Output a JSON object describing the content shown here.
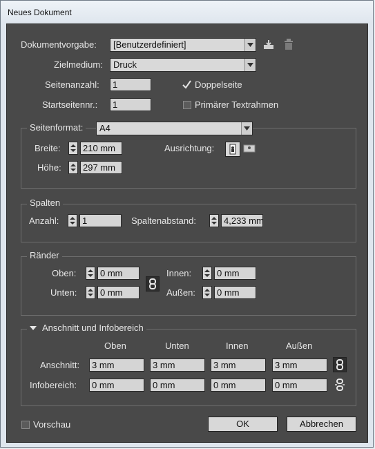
{
  "window": {
    "title": "Neues Dokument"
  },
  "preset": {
    "label": "Dokumentvorgabe:",
    "value": "[Benutzerdefiniert]"
  },
  "intent": {
    "label": "Zielmedium:",
    "value": "Druck"
  },
  "pages": {
    "label": "Seitenanzahl:",
    "value": "1"
  },
  "start_page": {
    "label": "Startseitennr.:",
    "value": "1"
  },
  "facing_pages": {
    "label": "Doppelseite",
    "checked": true
  },
  "primary_text_frame": {
    "label": "Primärer Textrahmen",
    "checked": false
  },
  "page_size": {
    "group_label": "Seitenformat:",
    "value": "A4",
    "width_label": "Breite:",
    "width_value": "210 mm",
    "height_label": "Höhe:",
    "height_value": "297 mm",
    "orientation_label": "Ausrichtung:"
  },
  "columns": {
    "group_label": "Spalten",
    "number_label": "Anzahl:",
    "number_value": "1",
    "gutter_label": "Spaltenabstand:",
    "gutter_value": "4,233 mm"
  },
  "margins": {
    "group_label": "Ränder",
    "top_label": "Oben:",
    "top_value": "0 mm",
    "bottom_label": "Unten:",
    "bottom_value": "0 mm",
    "inside_label": "Innen:",
    "inside_value": "0 mm",
    "outside_label": "Außen:",
    "outside_value": "0 mm"
  },
  "bleed_slug": {
    "group_label": "Anschnitt und Infobereich",
    "col_top": "Oben",
    "col_bottom": "Unten",
    "col_inside": "Innen",
    "col_outside": "Außen",
    "bleed_label": "Anschnitt:",
    "bleed_values": [
      "3 mm",
      "3 mm",
      "3 mm",
      "3 mm"
    ],
    "slug_label": "Infobereich:",
    "slug_values": [
      "0 mm",
      "0 mm",
      "0 mm",
      "0 mm"
    ]
  },
  "preview": {
    "label": "Vorschau",
    "checked": false
  },
  "buttons": {
    "ok": "OK",
    "cancel": "Abbrechen"
  },
  "icons": {
    "save_preset": "save-preset-icon",
    "delete_preset": "trash-icon",
    "portrait": "portrait-orientation-icon",
    "landscape": "landscape-orientation-icon",
    "link_margins": "chain-link-icon",
    "link_bleed": "chain-link-icon",
    "slug_link": "broken-chain-icon"
  }
}
